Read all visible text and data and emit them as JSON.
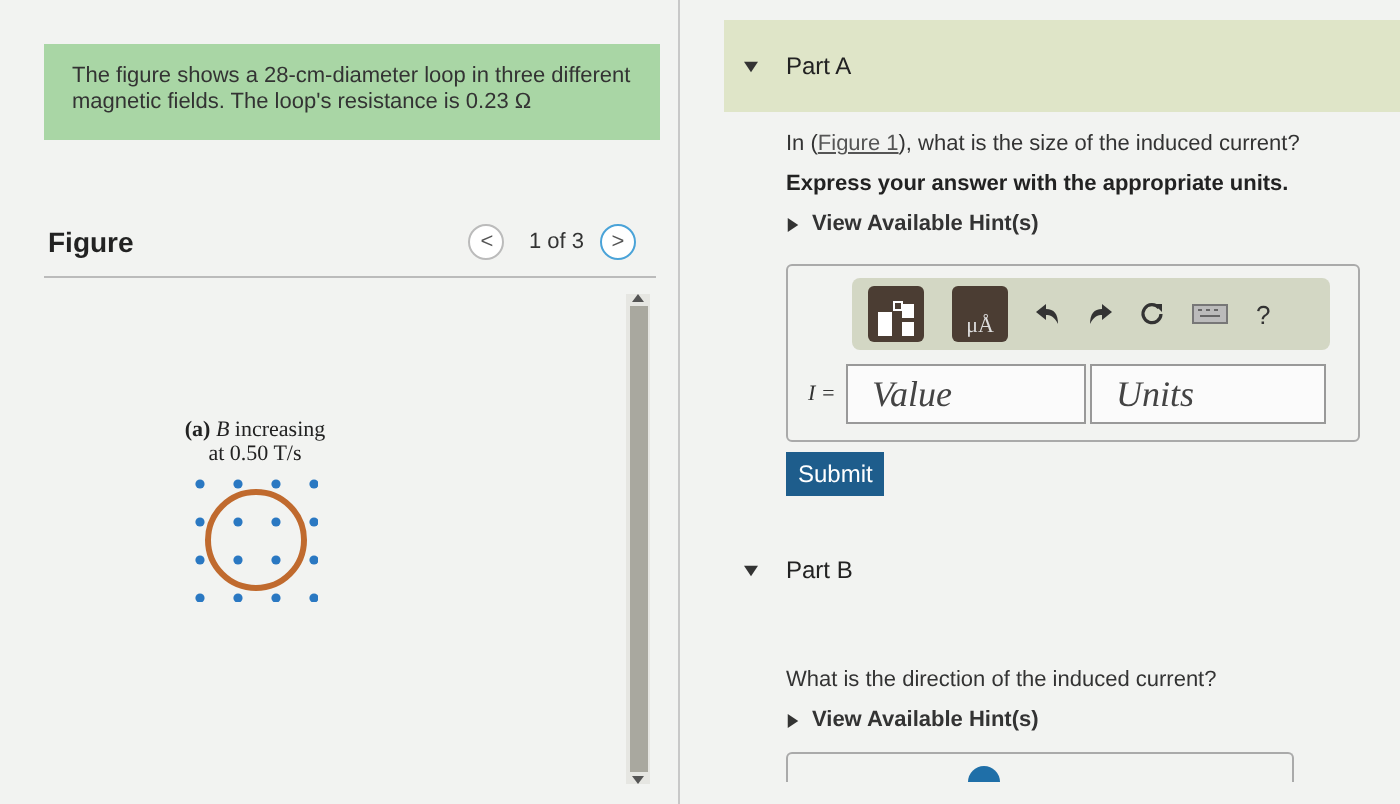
{
  "problem": {
    "text": "The figure shows a 28-cm-diameter loop in three different magnetic fields. The loop's resistance is 0.23 Ω"
  },
  "figure": {
    "title": "Figure",
    "prev": "<",
    "page": "1 of 3",
    "next": ">",
    "caption": [
      "**(a)** *B* increasing",
      "at 0.50 T/s"
    ]
  },
  "parts": [
    {
      "title": "Part A",
      "expanded": true,
      "active": true,
      "question_before": "In (",
      "link": "Figure 1",
      "question_after": "), what is the size of the induced current?",
      "instruction": "Express your answer with the appropriate units.",
      "hint": {
        "label": "View Available Hint(s)",
        "expanded": false
      },
      "answer": {
        "variable": "I =",
        "value_placeholder": "Value",
        "units_placeholder": "Units",
        "toolbar": [
          {
            "kind": "template"
          },
          {
            "kind": "units",
            "label": "μÅ"
          },
          {
            "kind": "undo"
          },
          {
            "kind": "redo"
          },
          {
            "kind": "reset"
          },
          {
            "kind": "keyboard"
          },
          {
            "kind": "help",
            "label": "?"
          }
        ]
      },
      "submit": "Submit"
    },
    {
      "title": "Part B",
      "expanded": true,
      "active": false,
      "question_before": "What is the direction of the induced current?",
      "hint": {
        "label": "View Available Hint(s)",
        "expanded": false
      }
    }
  ]
}
